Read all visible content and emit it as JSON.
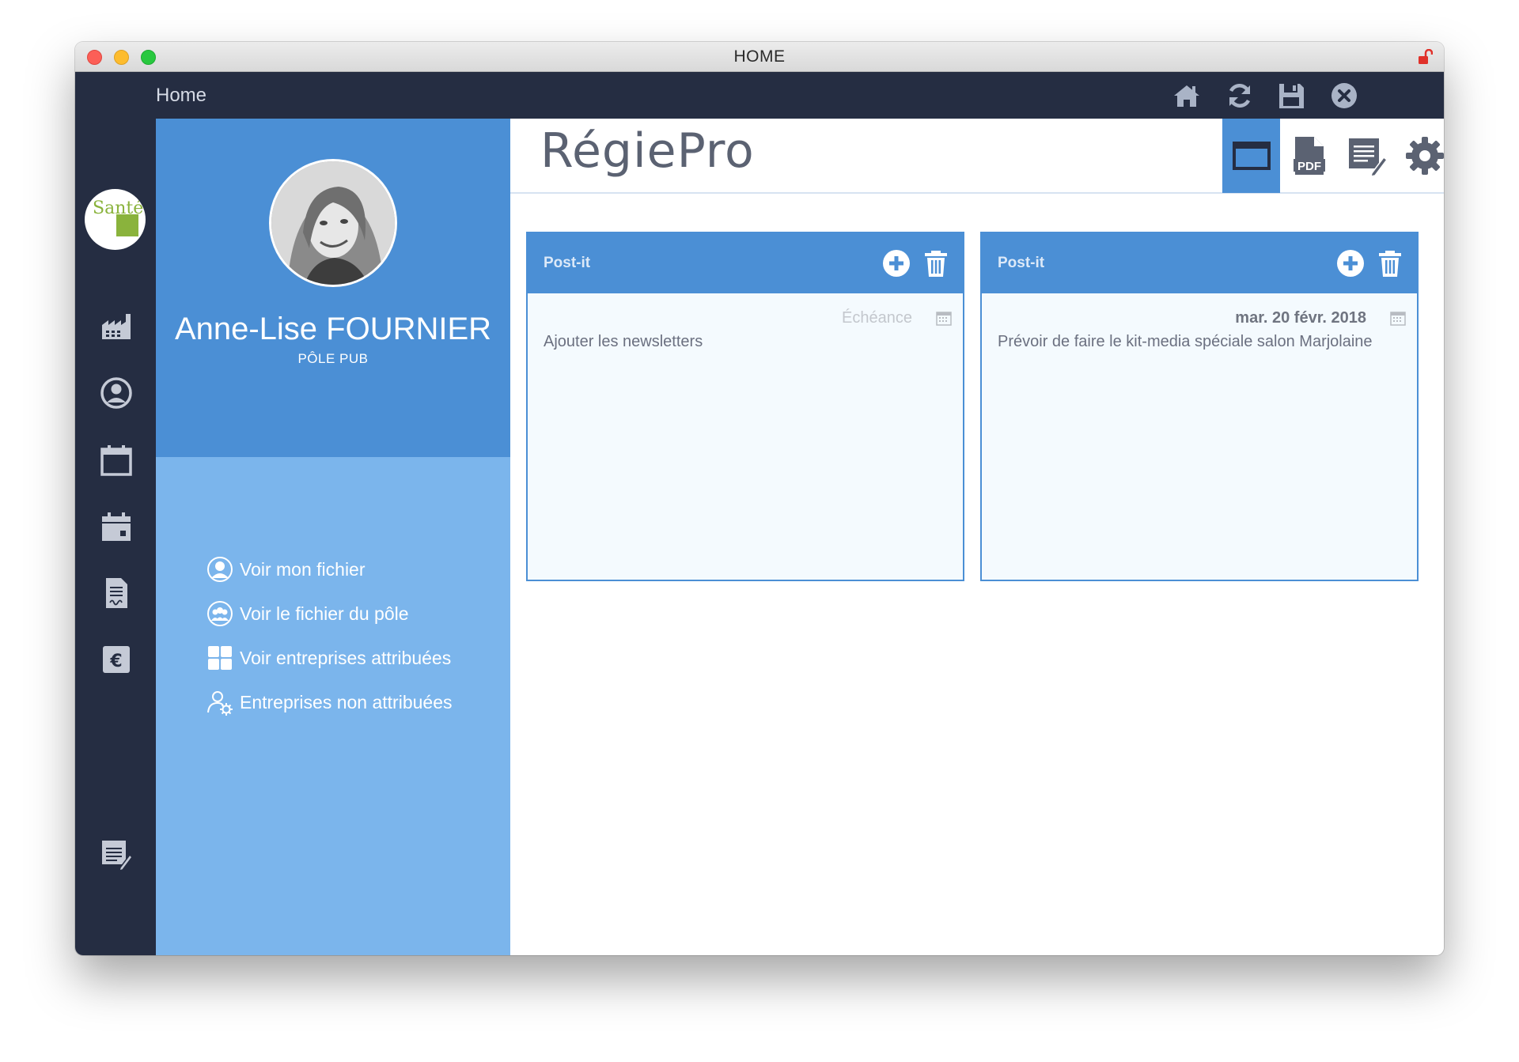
{
  "window": {
    "title": "HOME"
  },
  "header": {
    "breadcrumb": "Home",
    "icons": [
      "home-icon",
      "refresh-icon",
      "save-icon",
      "close-icon"
    ]
  },
  "sidebar": {
    "logo_text": "Santé",
    "icons": [
      "factory-icon",
      "user-icon",
      "calendar-icon",
      "calendar-event-icon",
      "document-icon",
      "euro-icon",
      "notes-icon"
    ]
  },
  "profile": {
    "name": "Anne-Lise FOURNIER",
    "role": "PÔLE PUB",
    "menu": [
      {
        "label": "Voir mon fichier",
        "icon": "user-circle-icon"
      },
      {
        "label": "Voir le fichier du pôle",
        "icon": "group-icon"
      },
      {
        "label": "Voir entreprises attribuées",
        "icon": "grid-icon"
      },
      {
        "label": "Entreprises non attribuées",
        "icon": "user-settings-icon"
      }
    ]
  },
  "main": {
    "app_title": "RégiePro",
    "toolbar": [
      "window-icon",
      "pdf-icon",
      "edit-list-icon",
      "settings-icon"
    ],
    "pdf_label": "PDF",
    "postits": [
      {
        "title": "Post-it",
        "date": "Échéance",
        "date_is_placeholder": true,
        "text": "Ajouter les newsletters"
      },
      {
        "title": "Post-it",
        "date": "mar. 20 févr. 2018",
        "date_is_placeholder": false,
        "text": "Prévoir de faire le kit-media spéciale salon Marjolaine"
      }
    ]
  },
  "colors": {
    "dark_navy": "#252d42",
    "primary_blue": "#4b8fd5",
    "light_blue": "#7bb5ec"
  }
}
